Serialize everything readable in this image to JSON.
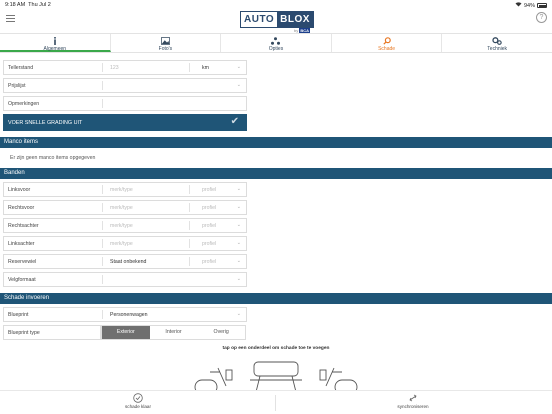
{
  "status": {
    "time": "9:18 AM",
    "date": "Thu Jul 2",
    "battery": "94%"
  },
  "brand": {
    "part1": "AUTO",
    "part2": "BLOX",
    "part3": "by",
    "part4": "BCA"
  },
  "tabs": [
    {
      "label": "Algemeen",
      "icon": "info-icon"
    },
    {
      "label": "Foto's",
      "icon": "photo-icon"
    },
    {
      "label": "Opties",
      "icon": "options-icon"
    },
    {
      "label": "Schade",
      "icon": "search-icon"
    },
    {
      "label": "Techniek",
      "icon": "gears-icon"
    }
  ],
  "general": {
    "tellerstand_label": "Tellerstand",
    "tellerstand_placeholder": "123",
    "tellerstand_unit": "km",
    "prijslijst_label": "Prijslijst",
    "opmerkingen_label": "Opmerkingen",
    "grading_button": "VOER SNELLE GRADING UIT"
  },
  "manco": {
    "title": "Manco items",
    "empty_text": "Er zijn geen manco items opgegeven"
  },
  "banden": {
    "title": "Banden",
    "rows": [
      {
        "label": "Linksvoor",
        "value": "merk/type",
        "profile": "profiel"
      },
      {
        "label": "Rechtsvoor",
        "value": "merk/type",
        "profile": "profiel"
      },
      {
        "label": "Rechtsachter",
        "value": "merk/type",
        "profile": "profiel"
      },
      {
        "label": "Linksachter",
        "value": "merk/type",
        "profile": "profiel"
      },
      {
        "label": "Reservewiel",
        "value": "Staat onbekend",
        "profile": "profiel"
      }
    ],
    "velgformaat_label": "Velgformaat"
  },
  "schade": {
    "title": "Schade invoeren",
    "blueprint_label": "Blueprint",
    "blueprint_value": "Personenwagen",
    "blueprint_type_label": "Blueprint type",
    "segments": [
      "Exterior",
      "Interior",
      "Overig"
    ],
    "active_segment": "Exterior",
    "hint": "tap op een onderdeel om schade toe te voegen"
  },
  "bottom": {
    "left": "schade klaar",
    "right": "synchroniseren"
  },
  "colors": {
    "navy": "#1f5577",
    "accent_green": "#3aa84a",
    "accent_orange": "#e87722"
  }
}
